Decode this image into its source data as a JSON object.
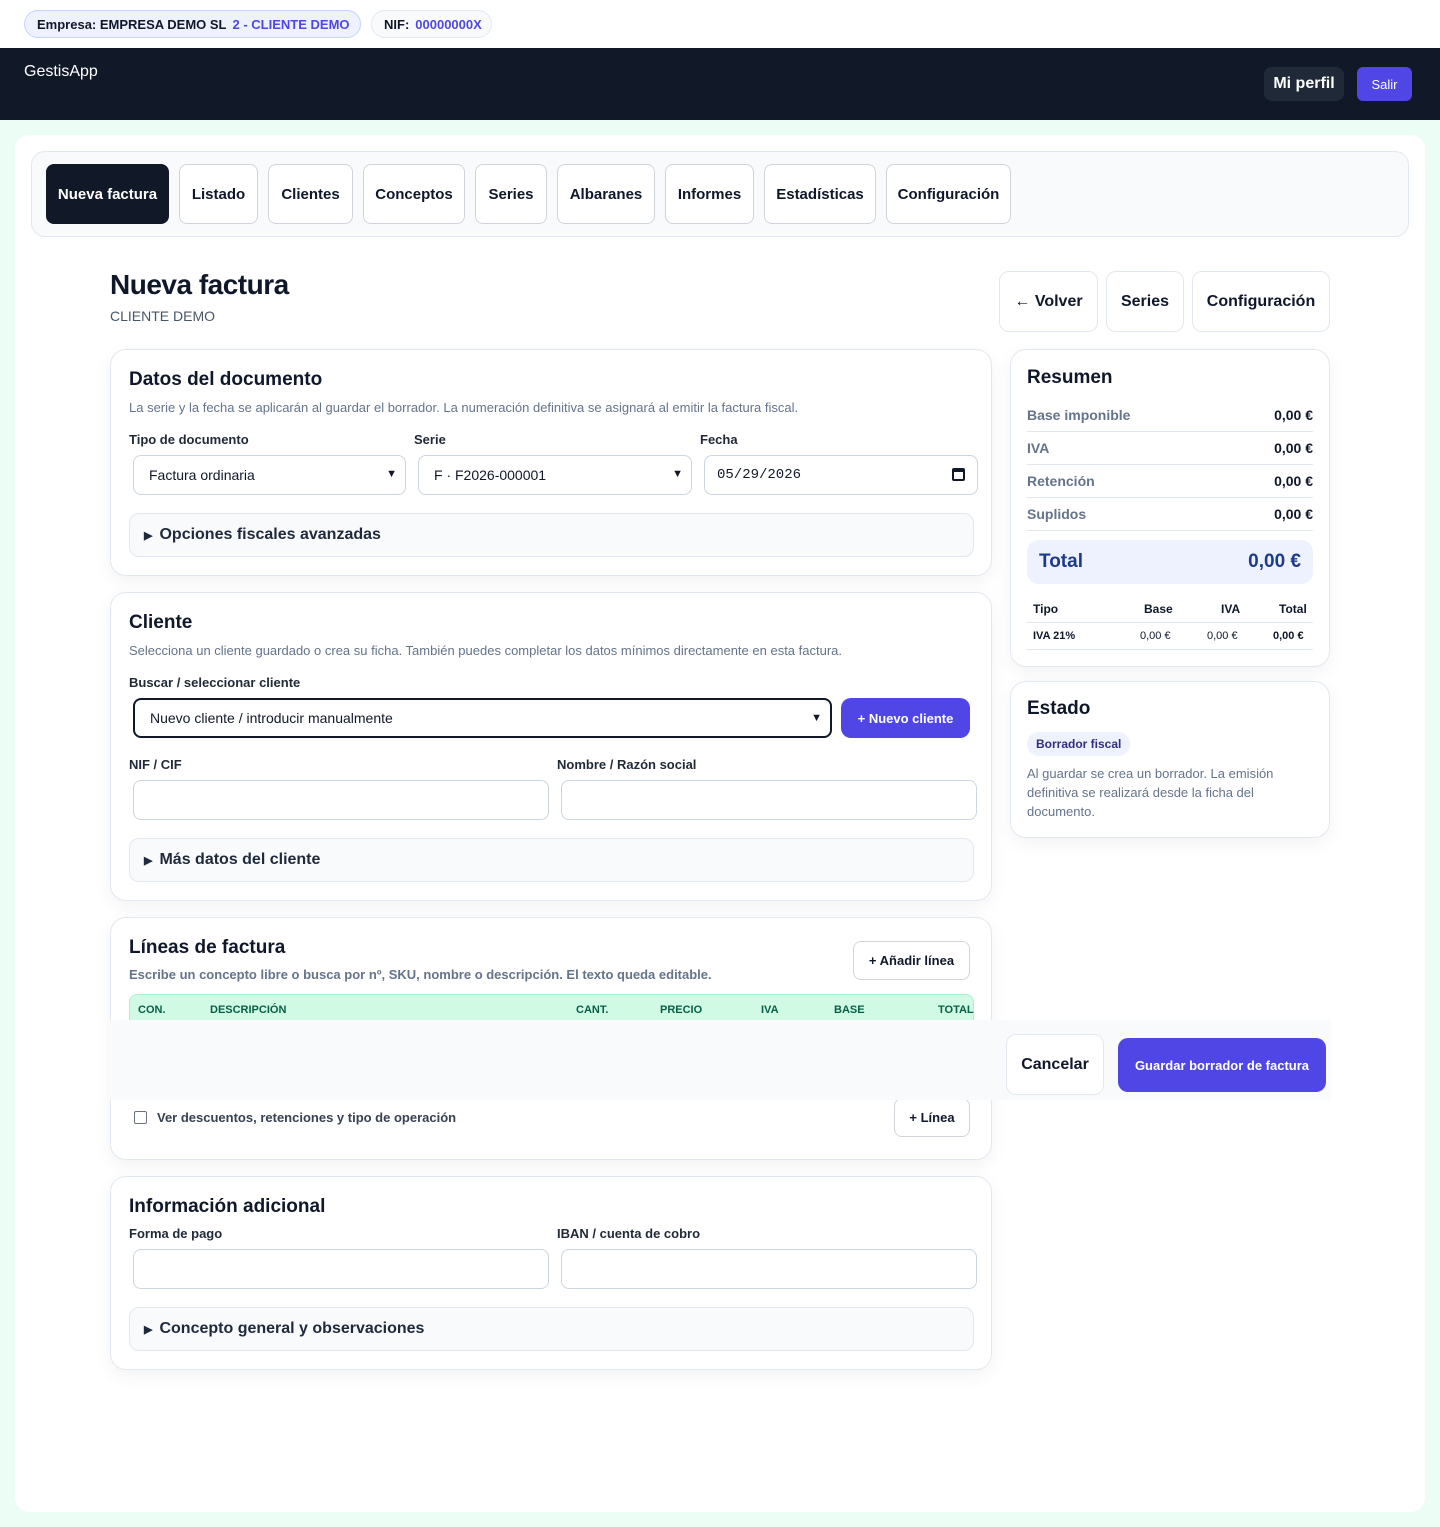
{
  "company_bar": {
    "empresa_label": "Empresa: EMPRESA DEMO SL",
    "cliente": "2 - CLIENTE DEMO",
    "nif_label": "NIF:",
    "nif_value": "00000000X"
  },
  "header": {
    "brand": "GestisApp",
    "profile_label": "Mi perfil",
    "logout_label": "Salir"
  },
  "tabs": [
    "Nueva factura",
    "Listado",
    "Clientes",
    "Conceptos",
    "Series",
    "Albaranes",
    "Informes",
    "Estadísticas",
    "Configuración"
  ],
  "page": {
    "title": "Nueva factura",
    "subtitle": "CLIENTE DEMO",
    "back_label": "← Volver",
    "series_label": "Series",
    "config_label": "Configuración"
  },
  "documento": {
    "title": "Datos del documento",
    "description": "La serie y la fecha se aplicarán al guardar el borrador. La numeración definitiva se asignará al emitir la factura fiscal.",
    "tipo_label": "Tipo de documento",
    "tipo_value": "Factura ordinaria",
    "serie_label": "Serie",
    "serie_value": "F · F2026-000001",
    "fecha_label": "Fecha",
    "fecha_value": "05/29/2026",
    "advanced_label": "Opciones fiscales avanzadas"
  },
  "cliente": {
    "title": "Cliente",
    "description": "Selecciona un cliente guardado o crea su ficha. También puedes completar los datos mínimos directamente en esta factura.",
    "search_label": "Buscar / seleccionar cliente",
    "search_value": "Nuevo cliente / introducir manualmente",
    "new_button": "+ Nuevo cliente",
    "nif_label": "NIF / CIF",
    "nombre_label": "Nombre / Razón social",
    "more_label": "Más datos del cliente"
  },
  "lineas": {
    "title": "Líneas de factura",
    "description": "Escribe un concepto libre o busca por nº, SKU, nombre o descripción. El texto queda editable.",
    "add_button": "+ Añadir línea",
    "columns": [
      "CON.",
      "DESCRIPCIÓN",
      "CANT.",
      "PRECIO",
      "IVA",
      "BASE",
      "TOTAL"
    ],
    "discount_toggle": "Ver descuentos, retenciones y tipo de operación",
    "add_line_button": "+ Línea"
  },
  "actions": {
    "cancel": "Cancelar",
    "save": "Guardar borrador de factura"
  },
  "info": {
    "title": "Información adicional",
    "forma_pago_label": "Forma de pago",
    "iban_label": "IBAN / cuenta de cobro",
    "concepto_label": "Concepto general y observaciones"
  },
  "resumen": {
    "title": "Resumen",
    "rows": [
      {
        "label": "Base imponible",
        "value": "0,00 €"
      },
      {
        "label": "IVA",
        "value": "0,00 €"
      },
      {
        "label": "Retención",
        "value": "0,00 €"
      },
      {
        "label": "Suplidos",
        "value": "0,00 €"
      }
    ],
    "total_label": "Total",
    "total_value": "0,00 €",
    "vat_headers": [
      "Tipo",
      "Base",
      "IVA",
      "Total"
    ],
    "vat_row": [
      "IVA 21%",
      "0,00 €",
      "0,00 €",
      "0,00 €"
    ]
  },
  "estado": {
    "title": "Estado",
    "badge": "Borrador fiscal",
    "text": "Al guardar se crea un borrador. La emisión definitiva se realizará desde la ficha del documento."
  },
  "colors": {
    "accent": "#4f46e5",
    "header_bg": "#111827",
    "table_head_bg": "#d1fae5"
  }
}
